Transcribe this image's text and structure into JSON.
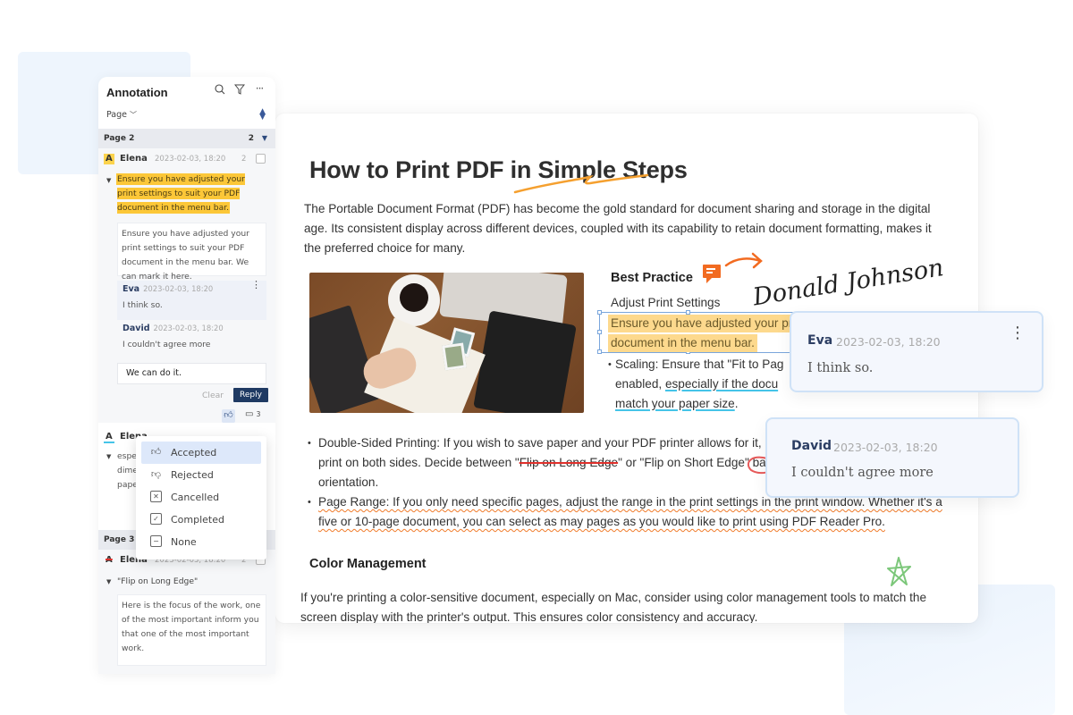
{
  "sidebar": {
    "title": "Annotation",
    "icons": [
      "search-icon",
      "filter-icon",
      "more-icon"
    ],
    "sort_by_label": "Page",
    "groups": [
      {
        "page_label": "Page 2",
        "count": "2",
        "annotations": [
          {
            "type_icon": "highlight-icon",
            "author": "Elena",
            "date": "2023-02-03, 18:20",
            "replies_count": "2",
            "quote": "Ensure you have adjusted your print settings to suit your PDF document in the menu bar.",
            "note": "Ensure you have adjusted your print settings to suit your PDF document in the menu bar. We can mark it here.",
            "replies": [
              {
                "author": "Eva",
                "date": "2023-02-03, 18:20",
                "text": "I think so."
              },
              {
                "author": "David",
                "date": "2023-02-03, 18:20",
                "text": "I couldn't agree more"
              }
            ],
            "reply_input_value": "We can do it.",
            "clear_label": "Clear",
            "reply_label": "Reply",
            "comment_count": "3"
          },
          {
            "type_icon": "underline-icon",
            "author": "Elena",
            "quote_lines": [
              "espe",
              "dime",
              "pape"
            ]
          }
        ]
      },
      {
        "page_label": "Page 3",
        "annotations": [
          {
            "type_icon": "strikeout-icon",
            "author": "Elena",
            "date": "2023-02-03, 18:20",
            "replies_count": "2",
            "quote": "\"Flip on Long Edge\"",
            "note": "Here is the focus of the work, one of the most important inform you that  one of the most important work."
          }
        ]
      }
    ]
  },
  "status_menu": {
    "items": [
      {
        "label": "Accepted",
        "icon": "thumbs-up-icon",
        "active": true
      },
      {
        "label": "Rejected",
        "icon": "thumbs-down-icon",
        "active": false
      },
      {
        "label": "Cancelled",
        "icon": "cancel-box-icon",
        "active": false
      },
      {
        "label": "Completed",
        "icon": "check-box-icon",
        "active": false
      },
      {
        "label": "None",
        "icon": "minus-box-icon",
        "active": false
      }
    ]
  },
  "document": {
    "title": "How to Print PDF in Simple Steps",
    "intro": "The Portable Document Format (PDF) has become the gold standard for document sharing and storage in the digital age. Its consistent display across different devices, coupled with its capability to retain document formatting, makes it the preferred choice for many.",
    "best_practice_title": "Best Practice",
    "best_practice_sub": "Adjust Print Settings",
    "highlight_line1": "Ensure you have adjusted your pr",
    "highlight_line2": "document in the menu bar.",
    "scaling_plain": "Scaling: Ensure that \"Fit to Pag",
    "scaling_plain2": "enabled, ",
    "scaling_underlined1": "especially if the docu",
    "scaling_underlined2": "match your paper size",
    "scaling_end": ".",
    "signature": "Donald Johnson",
    "double_sided": {
      "prefix": "Double-Sided Printing: If you wish to save paper and your PDF printer allows for it, m",
      "line2_a": "print on both sides. Decide between \"",
      "struck": "Flip on Long Edge",
      "line2_b": "\" or \"Flip on Short Edge\" bas",
      "line3": "orientation."
    },
    "page_range_line1": "Page Range: If you only need specific pages, adjust the range in the print settings in the print window. Whether it's a",
    "page_range_line2": "five or 10-page document, you can select as may pages as you would like to print using PDF Reader Pro.",
    "color_mgmt_title": "Color Management",
    "color_mgmt_para": "If you're printing a color-sensitive document, especially on Mac, consider using color management tools to match the screen display with the printer's output. This ensures color consistency and accuracy."
  },
  "floating_comments": [
    {
      "author": "Eva",
      "date": "2023-02-03, 18:20",
      "text": "I think so."
    },
    {
      "author": "David",
      "date": "2023-02-03, 18:20",
      "text": "I couldn't agree more"
    }
  ],
  "colors": {
    "highlight_yellow": "#fcc738",
    "doc_highlight": "#fdd98d",
    "accent_navy": "#1f3a63",
    "ink_orange": "#f07b2a",
    "strike_red": "#e0302b",
    "underline_cyan": "#45c4e8",
    "star_green": "#7cc77a"
  }
}
